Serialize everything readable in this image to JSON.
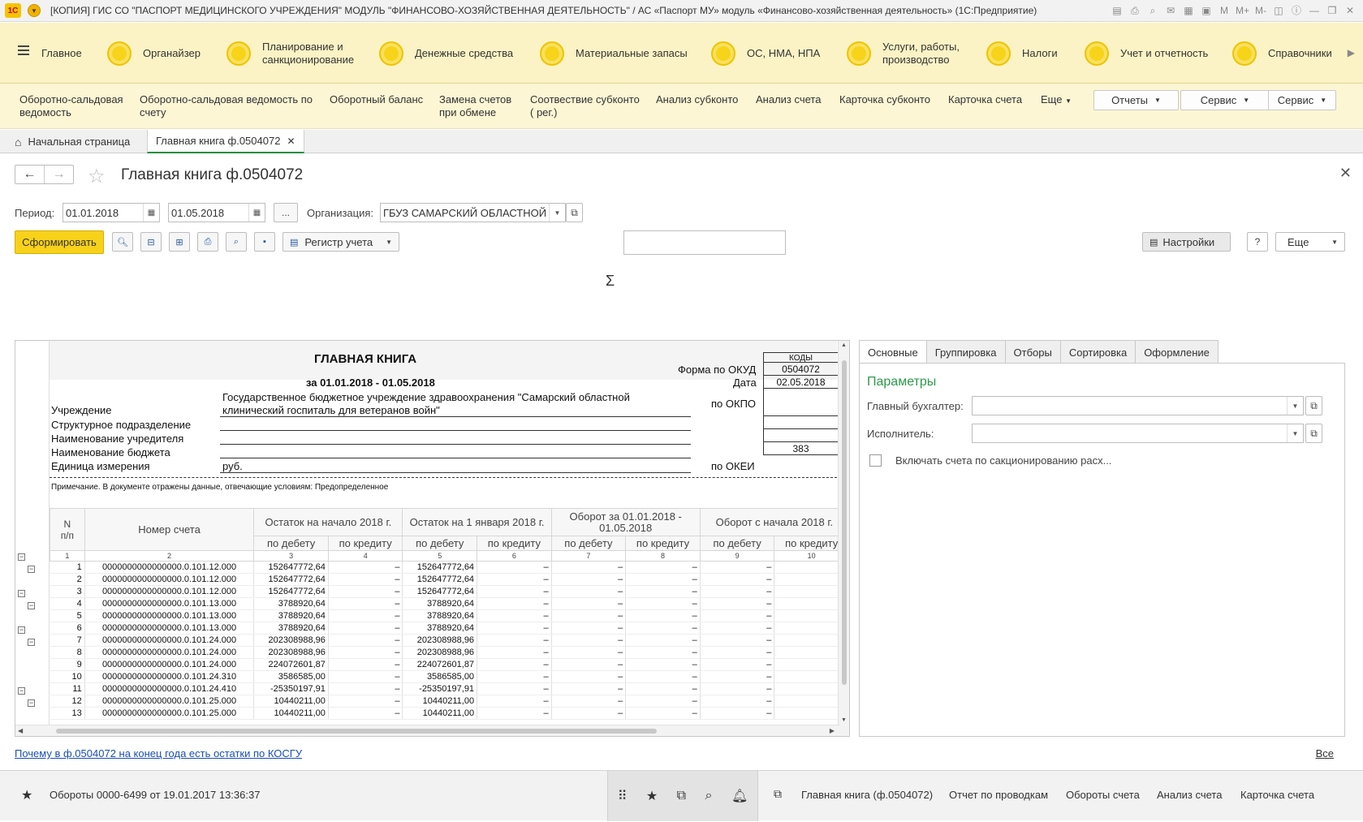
{
  "window": {
    "title": "[КОПИЯ] ГИС СО \"ПАСПОРТ МЕДИЦИНСКОГО УЧРЕЖДЕНИЯ\" МОДУЛЬ \"ФИНАНСОВО-ХОЗЯЙСТВЕННАЯ ДЕЯТЕЛЬНОСТЬ\" / АС «Паспорт МУ» модуль «Финансово-хозяйственная деятельность» (1С:Предприятие)",
    "logo_text": "1С"
  },
  "sections": [
    {
      "label": "Главное"
    },
    {
      "label": "Органайзер"
    },
    {
      "label": "Планирование и\nсанкционирование"
    },
    {
      "label": "Денежные средства"
    },
    {
      "label": "Материальные запасы"
    },
    {
      "label": "ОС, НМА, НПА"
    },
    {
      "label": "Услуги, работы,\nпроизводство"
    },
    {
      "label": "Налоги"
    },
    {
      "label": "Учет и отчетность"
    },
    {
      "label": "Справочники"
    }
  ],
  "functions": [
    {
      "label": "Оборотно-сальдовая\nведомость"
    },
    {
      "label": "Оборотно-сальдовая ведомость по\nсчету"
    },
    {
      "label": "Оборотный баланс"
    },
    {
      "label": "Замена счетов\nпри обмене"
    },
    {
      "label": "Соотвествие субконто\n( рег.)"
    },
    {
      "label": "Анализ субконто"
    },
    {
      "label": "Анализ счета"
    },
    {
      "label": "Карточка субконто"
    },
    {
      "label": "Карточка счета"
    },
    {
      "label": "Еще"
    }
  ],
  "function_buttons": {
    "reports": "Отчеты",
    "service1": "Сервис",
    "service2": "Сервис"
  },
  "open_tabs": {
    "home": "Начальная страница",
    "active": "Главная книга ф.0504072"
  },
  "form": {
    "title": "Главная книга ф.0504072",
    "period_label": "Период:",
    "date_from": "01.01.2018",
    "date_to": "01.05.2018",
    "dots": "...",
    "org_label": "Организация:",
    "org_value": "ГБУЗ САМАРСКИЙ ОБЛАСТНОЙ",
    "generate": "Сформировать",
    "register": "Регистр учета",
    "settings": "Настройки",
    "help": "?",
    "more": "Еще",
    "sigma": "Σ"
  },
  "report": {
    "heading": "ГЛАВНАЯ КНИГА",
    "period": "за 01.01.2018 - 01.05.2018",
    "codes": "КОДЫ",
    "okud_label": "Форма по ОКУД",
    "okud": "0504072",
    "date_label": "Дата",
    "date": "02.05.2018",
    "okpo_label": "по ОКПО",
    "okei_label": "по ОКЕИ",
    "okei": "383",
    "inst_label": "Учреждение",
    "inst_value_1": "Государственное бюджетное учреждение здравоохранения \"Самарский областной",
    "inst_value_2": "клинический госпиталь для ветеранов войн\"",
    "struct_label": "Структурное подразделение",
    "founder_label": "Наименование учредителя",
    "budget_label": "Наименование бюджета",
    "unit_label": "Единица измерения",
    "unit_value": "руб.",
    "note": "Примечание. В документе отражены данные, отвечающие условиям: Предопределенное",
    "headers": {
      "n": "N\nп/п",
      "account": "Номер счета",
      "bal_start_year": "Остаток на начало 2018 г.",
      "bal_jan1": "Остаток на 1 января 2018 г.",
      "turnover": "Оборот за 01.01.2018 -\n01.05.2018",
      "turnover_year": "Оборот с начала 2018 г.",
      "debit": "по дебету",
      "credit": "по кредиту"
    },
    "colnums": [
      "1",
      "2",
      "3",
      "4",
      "5",
      "6",
      "7",
      "8",
      "9",
      "10"
    ],
    "rows": [
      {
        "n": "1",
        "acc": "0000000000000000.0.101.12.000",
        "d1": "152647772,64",
        "c1": "–",
        "d2": "152647772,64",
        "c2": "–",
        "d3": "–",
        "c3": "–",
        "d4": "–"
      },
      {
        "n": "2",
        "acc": "0000000000000000.0.101.12.000",
        "d1": "152647772,64",
        "c1": "–",
        "d2": "152647772,64",
        "c2": "–",
        "d3": "–",
        "c3": "–",
        "d4": "–"
      },
      {
        "n": "3",
        "acc": "0000000000000000.0.101.12.000",
        "d1": "152647772,64",
        "c1": "–",
        "d2": "152647772,64",
        "c2": "–",
        "d3": "–",
        "c3": "–",
        "d4": "–"
      },
      {
        "n": "4",
        "acc": "0000000000000000.0.101.13.000",
        "d1": "3788920,64",
        "c1": "–",
        "d2": "3788920,64",
        "c2": "–",
        "d3": "–",
        "c3": "–",
        "d4": "–"
      },
      {
        "n": "5",
        "acc": "0000000000000000.0.101.13.000",
        "d1": "3788920,64",
        "c1": "–",
        "d2": "3788920,64",
        "c2": "–",
        "d3": "–",
        "c3": "–",
        "d4": "–"
      },
      {
        "n": "6",
        "acc": "0000000000000000.0.101.13.000",
        "d1": "3788920,64",
        "c1": "–",
        "d2": "3788920,64",
        "c2": "–",
        "d3": "–",
        "c3": "–",
        "d4": "–"
      },
      {
        "n": "7",
        "acc": "0000000000000000.0.101.24.000",
        "d1": "202308988,96",
        "c1": "–",
        "d2": "202308988,96",
        "c2": "–",
        "d3": "–",
        "c3": "–",
        "d4": "–"
      },
      {
        "n": "8",
        "acc": "0000000000000000.0.101.24.000",
        "d1": "202308988,96",
        "c1": "–",
        "d2": "202308988,96",
        "c2": "–",
        "d3": "–",
        "c3": "–",
        "d4": "–"
      },
      {
        "n": "9",
        "acc": "0000000000000000.0.101.24.000",
        "d1": "224072601,87",
        "c1": "–",
        "d2": "224072601,87",
        "c2": "–",
        "d3": "–",
        "c3": "–",
        "d4": "–"
      },
      {
        "n": "10",
        "acc": "0000000000000000.0.101.24.310",
        "d1": "3586585,00",
        "c1": "–",
        "d2": "3586585,00",
        "c2": "–",
        "d3": "–",
        "c3": "–",
        "d4": "–"
      },
      {
        "n": "11",
        "acc": "0000000000000000.0.101.24.410",
        "d1": "-25350197,91",
        "c1": "–",
        "d2": "-25350197,91",
        "c2": "–",
        "d3": "–",
        "c3": "–",
        "d4": "–"
      },
      {
        "n": "12",
        "acc": "0000000000000000.0.101.25.000",
        "d1": "10440211,00",
        "c1": "–",
        "d2": "10440211,00",
        "c2": "–",
        "d3": "–",
        "c3": "–",
        "d4": "–"
      },
      {
        "n": "13",
        "acc": "0000000000000000.0.101.25.000",
        "d1": "10440211,00",
        "c1": "–",
        "d2": "10440211,00",
        "c2": "–",
        "d3": "–",
        "c3": "–",
        "d4": "–"
      }
    ]
  },
  "settings": {
    "tabs": [
      "Основные",
      "Группировка",
      "Отборы",
      "Сортировка",
      "Оформление"
    ],
    "title": "Параметры",
    "chief_label": "Главный бухгалтер:",
    "exec_label": "Исполнитель:",
    "checkbox_label": "Включать счета по сакционированию расх..."
  },
  "bottom": {
    "link": "Почему в ф.0504072 на конец года есть остатки по КОСГУ",
    "all": "Все"
  },
  "statusbar": {
    "history": "Обороты 0000-6499 от 19.01.2017 13:36:37",
    "open_items": [
      "Главная книга (ф.0504072)",
      "Отчет по проводкам",
      "Обороты счета",
      "Анализ счета",
      "Карточка счета"
    ]
  },
  "colors": {
    "accent_yellow": "#f7d11a",
    "green": "#2c9a4a",
    "link": "#1a4fb4"
  }
}
